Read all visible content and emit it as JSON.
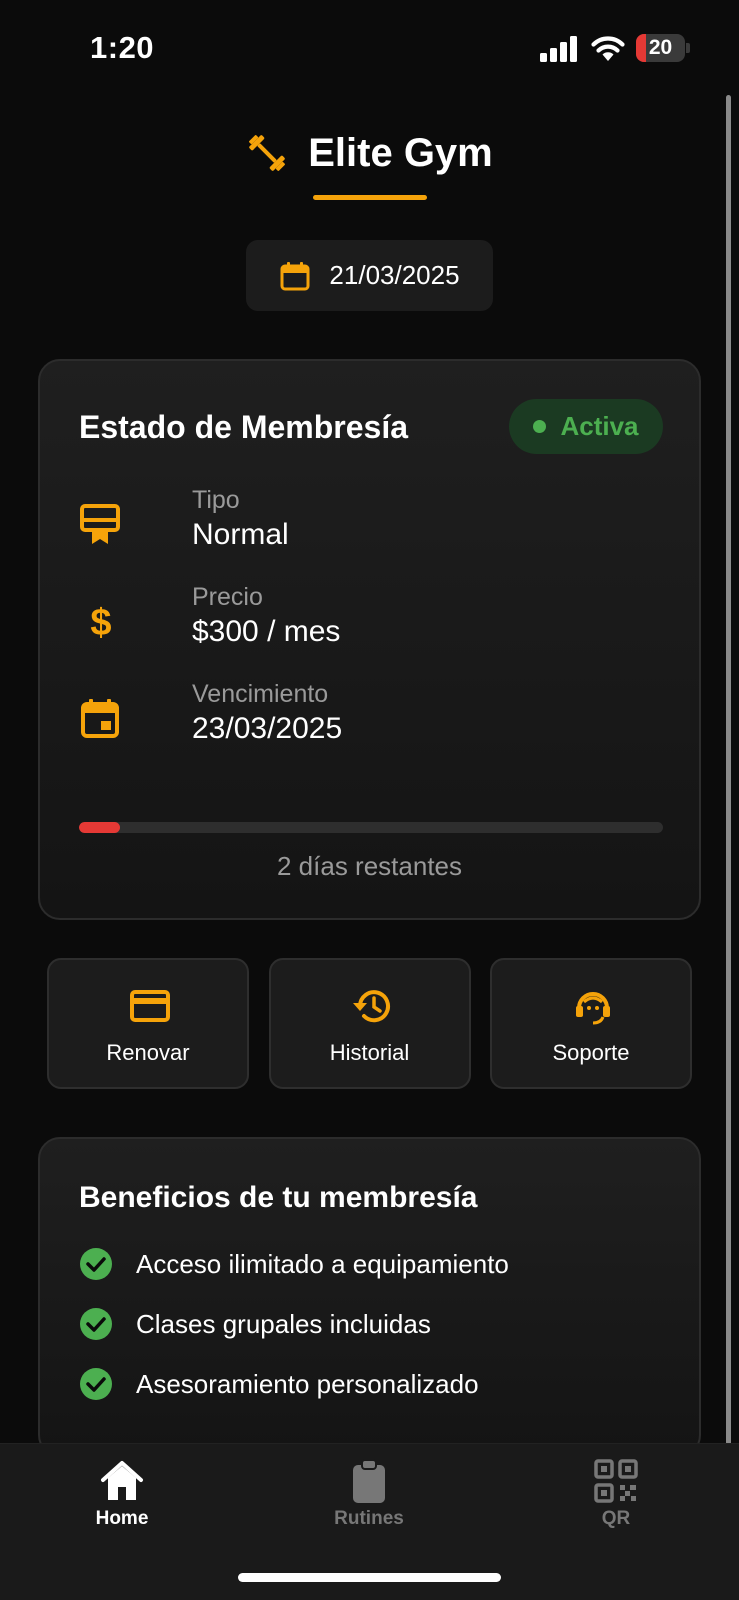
{
  "status_bar": {
    "time": "1:20",
    "battery_level": "20",
    "battery_fraction": 0.2,
    "icons": [
      "signal-icon",
      "wifi-icon",
      "battery-icon"
    ]
  },
  "header": {
    "app_title": "Elite Gym",
    "logo_icon": "dumbbell-icon",
    "date": "21/03/2025",
    "date_icon": "calendar-icon"
  },
  "membership": {
    "title": "Estado de Membresía",
    "status": "Activa",
    "status_color": "#4caf50",
    "rows": [
      {
        "icon": "membership-card-icon",
        "label": "Tipo",
        "value": "Normal"
      },
      {
        "icon": "dollar-icon",
        "label": "Precio",
        "value": "$300 / mes"
      },
      {
        "icon": "calendar-event-icon",
        "label": "Vencimiento",
        "value": "23/03/2025"
      }
    ],
    "progress_fraction": 0.07,
    "progress_color": "#e53935",
    "remaining_text": "2 días restantes"
  },
  "actions": [
    {
      "icon": "credit-card-icon",
      "label": "Renovar"
    },
    {
      "icon": "history-icon",
      "label": "Historial"
    },
    {
      "icon": "support-agent-icon",
      "label": "Soporte"
    }
  ],
  "benefits": {
    "title": "Beneficios de tu membresía",
    "items": [
      "Acceso ilimitado a equipamiento",
      "Clases grupales incluidas",
      "Asesoramiento personalizado"
    ],
    "check_color": "#4caf50"
  },
  "tab_bar": {
    "tabs": [
      {
        "icon": "home-icon",
        "label": "Home",
        "active": true
      },
      {
        "icon": "clipboard-icon",
        "label": "Rutines",
        "active": false
      },
      {
        "icon": "qr-code-icon",
        "label": "QR",
        "active": false
      }
    ]
  },
  "colors": {
    "accent": "#f5a30a",
    "background": "#0b0b0b",
    "card": "#1c1c1c"
  }
}
